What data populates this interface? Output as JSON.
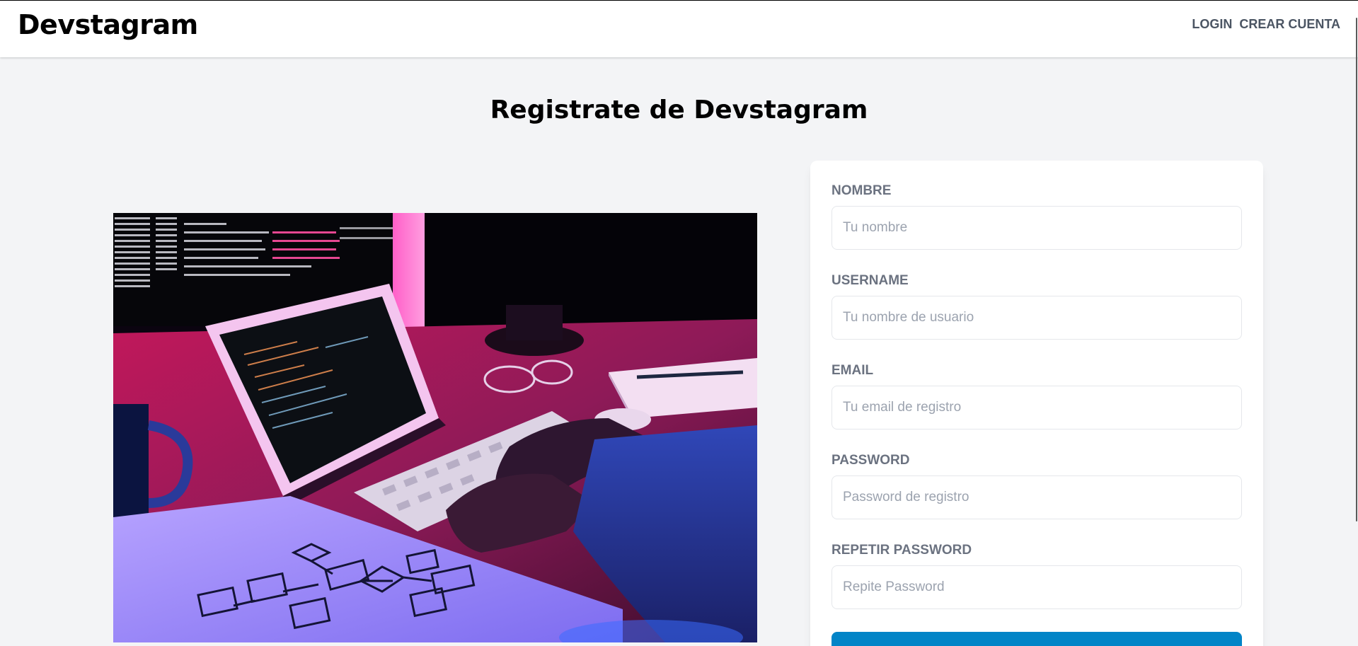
{
  "header": {
    "brand": "Devstagram",
    "nav": [
      {
        "label": "LOGIN"
      },
      {
        "label": "CREAR CUENTA"
      }
    ]
  },
  "page": {
    "title": "Registrate de Devstagram"
  },
  "hero_image": {
    "alt": "Developer typing on keyboard at desk with tablet and monitors",
    "icon": "photo"
  },
  "form": {
    "fields": [
      {
        "label": "NOMBRE",
        "placeholder": "Tu nombre",
        "value": ""
      },
      {
        "label": "USERNAME",
        "placeholder": "Tu nombre de usuario",
        "value": ""
      },
      {
        "label": "EMAIL",
        "placeholder": "Tu email de registro",
        "value": ""
      },
      {
        "label": "PASSWORD",
        "placeholder": "Password de registro",
        "value": ""
      },
      {
        "label": "REPETIR PASSWORD",
        "placeholder": "Repite Password",
        "value": ""
      }
    ],
    "submit_label": ""
  },
  "colors": {
    "background": "#f3f4f6",
    "accent": "#0284c7",
    "label": "#6b7280",
    "nav": "#4b5563"
  }
}
